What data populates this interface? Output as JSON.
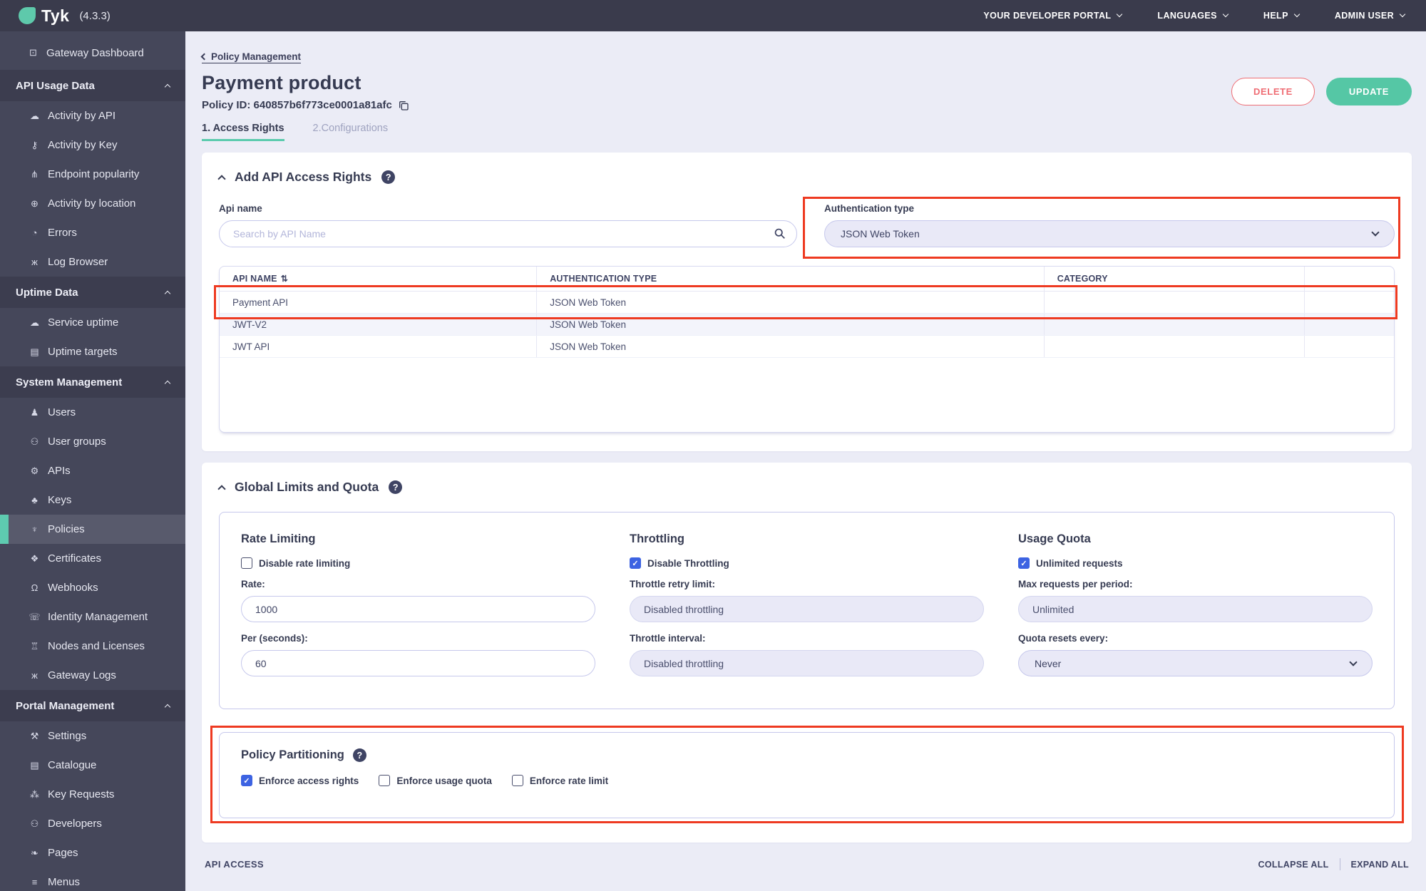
{
  "topbar": {
    "logo_text": "Tyk",
    "version": "(4.3.3)",
    "menus": [
      {
        "label": "YOUR DEVELOPER PORTAL"
      },
      {
        "label": "LANGUAGES"
      },
      {
        "label": "HELP"
      },
      {
        "label": "ADMIN USER"
      }
    ]
  },
  "sidebar": {
    "items": [
      {
        "label": "Gateway Dashboard",
        "icon": "monitor-icon"
      },
      {
        "label": "API Usage Data",
        "type": "section"
      },
      {
        "label": "Activity by API",
        "icon": "cloud-icon"
      },
      {
        "label": "Activity by Key",
        "icon": "key-icon"
      },
      {
        "label": "Endpoint popularity",
        "icon": "fork-icon"
      },
      {
        "label": "Activity by location",
        "icon": "globe-icon"
      },
      {
        "label": "Errors",
        "icon": "pie-chart-icon"
      },
      {
        "label": "Log Browser",
        "icon": "bug-icon"
      },
      {
        "label": "Uptime Data",
        "type": "section"
      },
      {
        "label": "Service uptime",
        "icon": "cloud-icon"
      },
      {
        "label": "Uptime targets",
        "icon": "list-icon"
      },
      {
        "label": "System Management",
        "type": "section"
      },
      {
        "label": "Users",
        "icon": "user-icon"
      },
      {
        "label": "User groups",
        "icon": "users-icon"
      },
      {
        "label": "APIs",
        "icon": "gears-icon"
      },
      {
        "label": "Keys",
        "icon": "hierarchy-icon"
      },
      {
        "label": "Policies",
        "icon": "plug-icon",
        "active": true
      },
      {
        "label": "Certificates",
        "icon": "seal-icon"
      },
      {
        "label": "Webhooks",
        "icon": "bell-icon"
      },
      {
        "label": "Identity Management",
        "icon": "handset-icon"
      },
      {
        "label": "Nodes and Licenses",
        "icon": "bank-icon"
      },
      {
        "label": "Gateway Logs",
        "icon": "bug-icon"
      },
      {
        "label": "Portal Management",
        "type": "section"
      },
      {
        "label": "Settings",
        "icon": "wrench-icon"
      },
      {
        "label": "Catalogue",
        "icon": "list-icon"
      },
      {
        "label": "Key Requests",
        "icon": "paw-icon"
      },
      {
        "label": "Developers",
        "icon": "users-icon"
      },
      {
        "label": "Pages",
        "icon": "leaf-icon"
      },
      {
        "label": "Menus",
        "icon": "menu-icon"
      }
    ]
  },
  "page": {
    "breadcrumb": "Policy Management",
    "title": "Payment product",
    "policy_id": "Policy ID: 640857b6f773ce0001a81afc",
    "tabs": [
      {
        "label": "1. Access Rights"
      },
      {
        "label": "2.Configurations"
      }
    ],
    "delete_button": "DELETE",
    "update_button": "UPDATE"
  },
  "access_rights": {
    "section_title": "Add API Access Rights",
    "api_name_label": "Api name",
    "search_placeholder": "Search by API Name",
    "auth_type_label": "Authentication type",
    "auth_type_value": "JSON Web Token",
    "table": {
      "columns": [
        "API NAME",
        "AUTHENTICATION TYPE",
        "CATEGORY"
      ],
      "rows": [
        {
          "api_name": "Payment API",
          "auth_type": "JSON Web Token",
          "category": ""
        },
        {
          "api_name": "JWT-V2",
          "auth_type": "JSON Web Token",
          "category": ""
        },
        {
          "api_name": "JWT API",
          "auth_type": "JSON Web Token",
          "category": ""
        }
      ]
    }
  },
  "global_limits": {
    "section_title": "Global Limits and Quota",
    "rate_limiting": {
      "title": "Rate Limiting",
      "checkbox_label": "Disable rate limiting",
      "checked": false,
      "rate_label": "Rate:",
      "rate_value": "1000",
      "per_label": "Per (seconds):",
      "per_value": "60"
    },
    "throttling": {
      "title": "Throttling",
      "checkbox_label": "Disable Throttling",
      "checked": true,
      "retry_label": "Throttle retry limit:",
      "retry_value": "Disabled throttling",
      "interval_label": "Throttle interval:",
      "interval_value": "Disabled throttling"
    },
    "usage_quota": {
      "title": "Usage Quota",
      "checkbox_label": "Unlimited requests",
      "checked": true,
      "max_label": "Max requests per period:",
      "max_value": "Unlimited",
      "resets_label": "Quota resets every:",
      "resets_value": "Never"
    }
  },
  "policy_partitioning": {
    "title": "Policy Partitioning",
    "checkboxes": [
      {
        "label": "Enforce access rights",
        "checked": true
      },
      {
        "label": "Enforce usage quota",
        "checked": false
      },
      {
        "label": "Enforce rate limit",
        "checked": false
      }
    ]
  },
  "footer": {
    "left": "API ACCESS",
    "collapse_all": "COLLAPSE ALL",
    "expand_all": "EXPAND ALL"
  },
  "colors": {
    "accent_teal": "#55c7a5",
    "danger_red": "#ef6d74",
    "annotation_red": "#ee3a21",
    "checkbox_blue": "#3d63e2",
    "topbar_bg": "#3a3b4c",
    "sidebar_bg": "#45475a"
  }
}
